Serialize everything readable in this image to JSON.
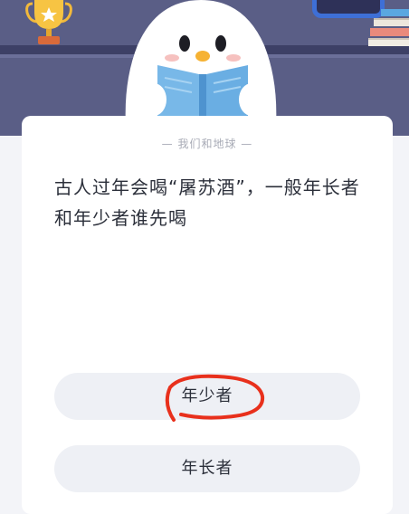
{
  "header": {
    "icons": [
      "trophy-icon",
      "books-icon",
      "picture-frame-icon",
      "mascot-penguin-reading"
    ]
  },
  "quiz": {
    "category": "— 我们和地球 —",
    "question": "古人过年会喝“屠苏酒”，一般年长者和年少者谁先喝",
    "options": [
      {
        "label": "年少者",
        "circled": true
      },
      {
        "label": "年长者",
        "circled": false
      }
    ]
  },
  "annotation": {
    "color": "#e8301c"
  }
}
